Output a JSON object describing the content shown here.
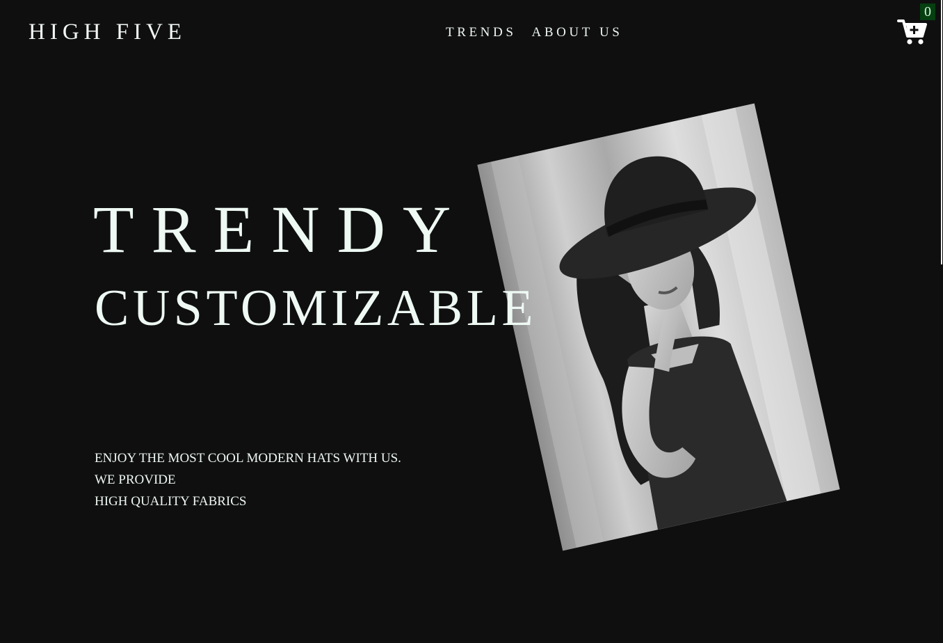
{
  "header": {
    "logo": "HIGH FIVE",
    "nav": [
      {
        "label": "TRENDS"
      },
      {
        "label": "ABOUT US"
      }
    ],
    "cart": {
      "icon": "cart-plus-icon",
      "count": "0"
    }
  },
  "hero": {
    "headline_line1": "TRENDY",
    "headline_line2": "CUSTOMIZABLE",
    "tagline": [
      "ENJOY THE MOST COOL MODERN HATS WITH US.",
      "WE PROVIDE",
      "HIGH QUALITY FABRICS"
    ],
    "photo": "woman-in-hat-photo"
  },
  "colors": {
    "background": "#0f0f10",
    "text": "#eef7f2",
    "badge_bg": "#063f10"
  }
}
